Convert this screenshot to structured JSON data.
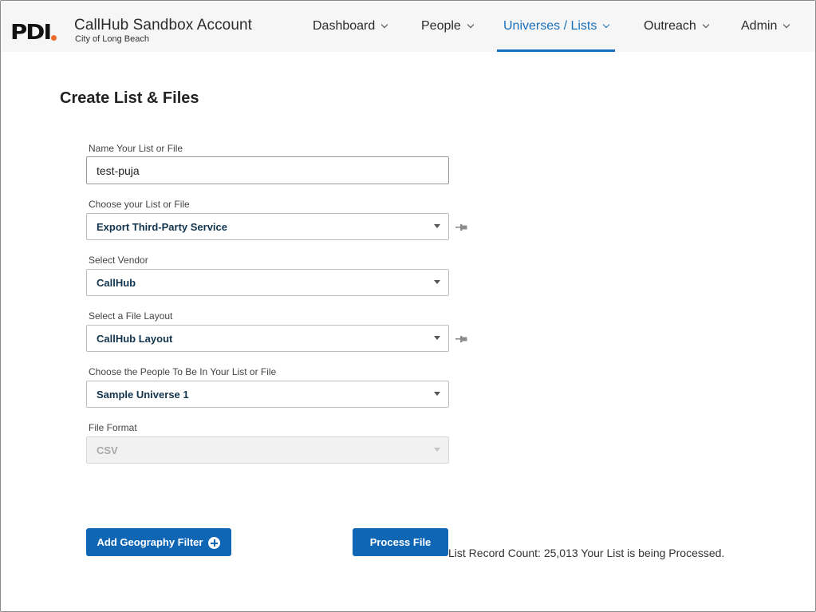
{
  "header": {
    "logo_text": "PDI",
    "account_name": "CallHub Sandbox Account",
    "account_sub": "City of Long Beach",
    "nav": [
      {
        "label": "Dashboard",
        "active": false
      },
      {
        "label": "People",
        "active": false
      },
      {
        "label": "Universes / Lists",
        "active": true
      },
      {
        "label": "Outreach",
        "active": false
      },
      {
        "label": "Admin",
        "active": false
      }
    ]
  },
  "page": {
    "title": "Create List & Files"
  },
  "form": {
    "name": {
      "label": "Name Your List or File",
      "value": "test-puja"
    },
    "list_type": {
      "label": "Choose your List or File",
      "value": "Export Third-Party Service"
    },
    "vendor": {
      "label": "Select Vendor",
      "value": "CallHub"
    },
    "layout": {
      "label": "Select a File Layout",
      "value": "CallHub Layout"
    },
    "people": {
      "label": "Choose the People To Be In Your List or File",
      "value": "Sample Universe 1"
    },
    "format": {
      "label": "File Format",
      "value": "CSV"
    }
  },
  "actions": {
    "add_geo_filter": "Add Geography Filter",
    "process_file": "Process File",
    "status": "List Record Count: 25,013 Your List is being Processed."
  },
  "colors": {
    "accent": "#0e66b5",
    "nav_active": "#1a6fbb",
    "logo_dot": "#ec6a2c"
  },
  "icons": {
    "pin": "pin-icon",
    "add": "plus-circle-icon",
    "nav_chevron": "chevron-down-icon",
    "select_caret": "caret-down-icon"
  }
}
